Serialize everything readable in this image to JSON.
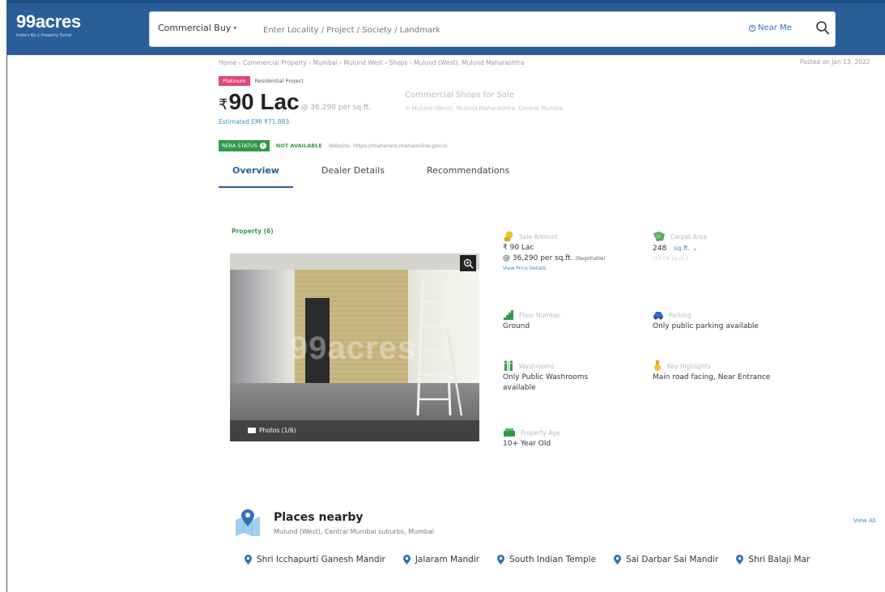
{
  "header": {
    "logo": "99acres",
    "logo_tagline": "India's No.1 Property Portal",
    "search_type": "Commercial Buy",
    "search_placeholder": "Enter Locality / Project / Society / Landmark",
    "near_me": "Near Me",
    "accent_color": "#2a5e98"
  },
  "listing": {
    "breadcrumb": "Home › Commercial Property › Mumbai › Mulund West › Shops › Mulund (West), Mulund Maharashtra",
    "posted": "Posted on Jan 13, 2022",
    "badge_primary": "Platinum",
    "badge_secondary": "Residential Project",
    "currency_symbol": "₹",
    "price": "90 Lac",
    "price_per_sqft": "@ 36,290 per sq.ft.",
    "title": "Commercial Shops for Sale",
    "subtitle": "in Mulund (West), Mulund Maharashtra, Central Mumbai",
    "emi": "Estimated EMI ₹71,883",
    "rera_status": "RERA STATUS",
    "rera_info_glyph": "i",
    "rera_value": "NOT AVAILABLE",
    "rera_website": "Website: https://maharera.mahaonline.gov.in"
  },
  "tabs": [
    "Overview",
    "Dealer Details",
    "Recommendations"
  ],
  "property": {
    "label": "Property (6)",
    "watermark": "99acres",
    "photos_count": "Photos (1/6)"
  },
  "details": {
    "price": {
      "label": "Sale Amount",
      "value": "₹ 90 Lac",
      "per_sqft": "@ 36,290 per sq.ft.",
      "negotiable": "(Negotiable)",
      "link": "View Price Details"
    },
    "carpet": {
      "label": "Carpet Area",
      "value": "248",
      "unit": "sq.ft.",
      "unit_caret": "⌄",
      "alt": "(23.04 sq.m.)"
    },
    "floor": {
      "label": "Floor Number",
      "value": "Ground"
    },
    "parking": {
      "label": "Parking",
      "value": "Only public parking available"
    },
    "washrooms": {
      "label": "Washrooms",
      "value_line1": "Only Public Washrooms",
      "value_line2": "available"
    },
    "highlights": {
      "label": "Key Highlights",
      "value": "Main road facing, Near Entrance"
    },
    "age": {
      "label": "Property Age",
      "value": "10+ Year Old"
    }
  },
  "places": {
    "title": "Places nearby",
    "subtitle": "Mulund (West), Central Mumbai suburbs, Mumbai",
    "view_all": "View All",
    "items": [
      "Shri Icchapurti Ganesh Mandir",
      "Jalaram Mandir",
      "South Indian Temple",
      "Sai Darbar Sai Mandir",
      "Shri Balaji Mar"
    ]
  }
}
